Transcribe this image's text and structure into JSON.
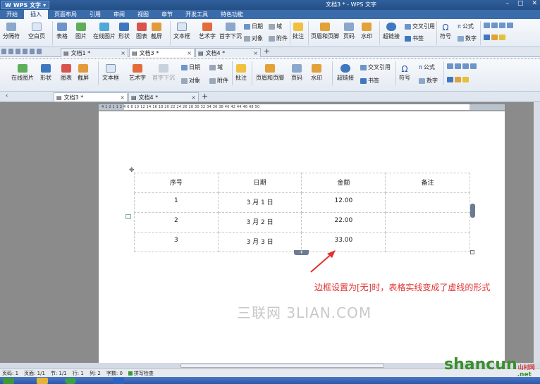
{
  "app": {
    "brand": "WPS 文字",
    "window_title": "文档3 * - WPS 文字"
  },
  "menu": [
    "开始",
    "插入",
    "页面布局",
    "引用",
    "审阅",
    "视图",
    "章节",
    "开发工具",
    "特色功能"
  ],
  "ribbon_top": {
    "page_break": "分隔符",
    "blank_page": "空白页",
    "table": "表格",
    "picture": "图片",
    "online_picture": "在线图片",
    "shapes": "形状",
    "chart": "图表",
    "screenshot": "截屏",
    "textbox": "文本框",
    "wordart": "艺术字",
    "dropcap": "首字下沉",
    "date": "日期",
    "field": "域",
    "object": "对象",
    "attachment": "附件",
    "comment": "批注",
    "header_footer": "页眉和页脚",
    "page_number": "页码",
    "watermark": "水印",
    "hyperlink": "超链接",
    "crossref": "交叉引用",
    "bookmark": "书签",
    "symbol": "符号",
    "formula": "公式",
    "number": "数字"
  },
  "ribbon_second": {
    "online_picture": "在线图片",
    "shapes": "形状",
    "chart": "图表",
    "screenshot": "截屏",
    "textbox": "文本框",
    "wordart": "艺术字",
    "dropcap": "首字下沉",
    "date": "日期",
    "field": "域",
    "object": "对象",
    "attachment": "附件",
    "comment": "批注",
    "header_footer": "页眉和页脚",
    "page_number": "页码",
    "watermark": "水印",
    "hyperlink": "超链接",
    "crossref": "交叉引用",
    "bookmark": "书签",
    "symbol": "符号",
    "formula": "公式",
    "number": "数字"
  },
  "tabs_top": [
    "文档1 *",
    "文档3 *",
    "文档4 *"
  ],
  "tabs_second": [
    "文档3 *",
    "文档4 *"
  ],
  "ruler_text": "4 1 2 1 1 2 4 6 8 10 12 14 16 18 20 22 24 26 28 30 32 34 36 38 40 42 44 46 48 50",
  "table": {
    "headers": [
      "序号",
      "日期",
      "金额",
      "备注"
    ],
    "rows": [
      [
        "1",
        "3 月 1 日",
        "12.00",
        ""
      ],
      [
        "2",
        "3 月 2 日",
        "22.00",
        ""
      ],
      [
        "3",
        "3 月 3 日",
        "33.00",
        ""
      ]
    ]
  },
  "annotation": "边框设置为[无]时，表格实线变成了虚线的形式",
  "watermark_text": "三联网 3LIAN.COM",
  "status": {
    "page": "页码: 1",
    "pages": "页面: 1/1",
    "section": "节: 1/1",
    "row": "行: 1",
    "col": "列: 2",
    "words": "字数: 0",
    "spell": "拼写检查"
  },
  "logo": {
    "main": "shancun",
    "sub": "山村网",
    "suffix": ".net"
  },
  "colors": {
    "accent": "#3a6cab",
    "annotation": "#e0302f",
    "logo_green": "#3b8f2c"
  }
}
